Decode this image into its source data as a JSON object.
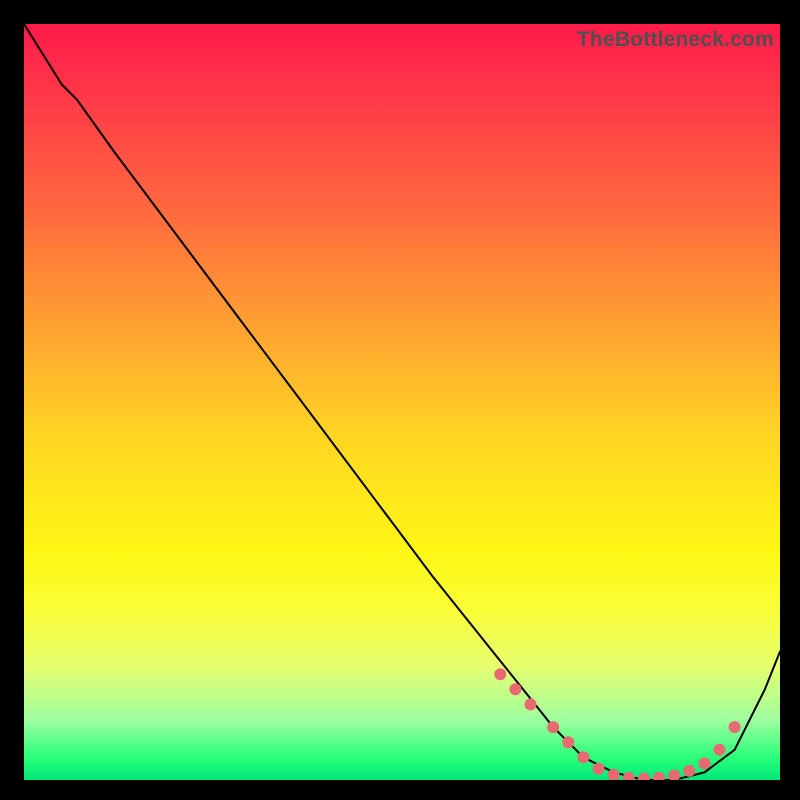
{
  "watermark": "TheBottleneck.com",
  "chart_data": {
    "type": "line",
    "title": "",
    "xlabel": "",
    "ylabel": "",
    "xlim": [
      0,
      100
    ],
    "ylim": [
      0,
      100
    ],
    "series": [
      {
        "name": "curve",
        "x": [
          0,
          5,
          7,
          12,
          18,
          24,
          30,
          36,
          42,
          48,
          54,
          58,
          62,
          66,
          70,
          74,
          78,
          82,
          86,
          90,
          94,
          98,
          100
        ],
        "y": [
          100,
          92,
          90,
          83,
          75,
          67,
          59,
          51,
          43,
          35,
          27,
          22,
          17,
          12,
          7,
          3,
          1,
          0,
          0,
          1,
          4,
          12,
          17
        ]
      }
    ],
    "markers": {
      "name": "highlight-dots",
      "x": [
        63,
        65,
        67,
        70,
        72,
        74,
        76,
        78,
        80,
        82,
        84,
        86,
        88,
        90,
        92,
        94
      ],
      "y": [
        14,
        12,
        10,
        7,
        5,
        3,
        1.5,
        0.7,
        0.3,
        0.2,
        0.3,
        0.6,
        1.2,
        2.2,
        4.0,
        7.0
      ]
    }
  }
}
